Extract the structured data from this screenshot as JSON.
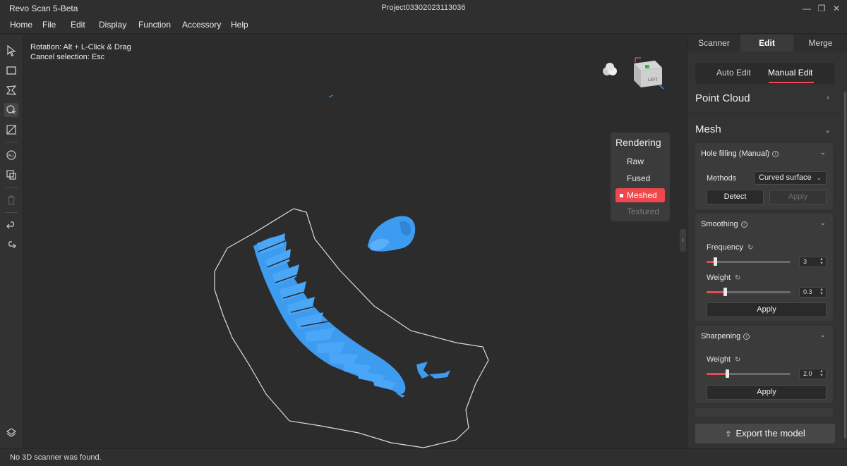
{
  "window": {
    "app_title": "Revo Scan 5-Beta",
    "project_title": "Project03302023113036",
    "minimize_icon": "minimize-icon",
    "maximize_icon": "restore-icon",
    "close_icon": "close-icon"
  },
  "menu": [
    "Home",
    "File",
    "Edit",
    "Display",
    "Function",
    "Accessory",
    "Help"
  ],
  "tools": [
    "select-arrow",
    "rectangle-select",
    "lasso-select",
    "brush-select",
    "invert-select",
    "mesh-clean",
    "copy-select",
    "delete",
    "undo",
    "redo",
    "layers"
  ],
  "viewport": {
    "hint_rotation": "Rotation:  Alt + L-Click & Drag",
    "hint_cancel": "Cancel selection:  Esc",
    "mesh_color": "#3d9bf0"
  },
  "rendering": {
    "title": "Rendering",
    "options": [
      "Raw",
      "Fused",
      "Meshed",
      "Textured"
    ],
    "selected": "Meshed",
    "disabled": "Textured"
  },
  "panel": {
    "tabs": [
      "Scanner",
      "Edit",
      "Merge"
    ],
    "active_tab": "Edit",
    "subtabs": [
      "Auto Edit",
      "Manual Edit"
    ],
    "active_subtab": "Manual Edit",
    "point_cloud": "Point Cloud",
    "mesh": "Mesh",
    "hole_filling": {
      "title": "Hole filling (Manual)",
      "methods_label": "Methods",
      "method_value": "Curved surface",
      "detect": "Detect",
      "apply": "Apply"
    },
    "smoothing": {
      "title": "Smoothing",
      "frequency_label": "Frequency",
      "frequency_value": "3",
      "frequency_fraction": 0.1,
      "weight_label": "Weight",
      "weight_value": "0.3",
      "weight_fraction": 0.22,
      "apply": "Apply"
    },
    "sharpening": {
      "title": "Sharpening",
      "weight_label": "Weight",
      "weight_value": "2.0",
      "weight_fraction": 0.24,
      "apply": "Apply"
    },
    "export": "Export the model"
  },
  "status": "No 3D scanner was found.",
  "colors": {
    "accent": "#f0474f",
    "mesh": "#3d9bf0"
  }
}
